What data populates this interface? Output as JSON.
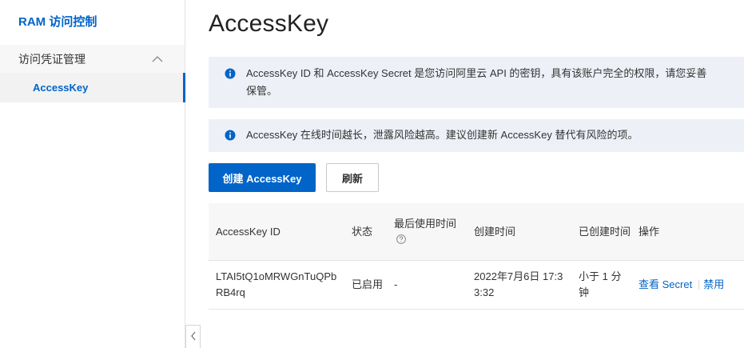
{
  "sidebar": {
    "brand": "RAM 访问控制",
    "group_label": "访问凭证管理",
    "items": [
      {
        "label": "AccessKey"
      }
    ]
  },
  "main": {
    "title": "AccessKey",
    "notices": [
      {
        "text": "AccessKey ID 和 AccessKey Secret 是您访问阿里云 API 的密钥，具有该账户完全的权限，请您妥善保管。"
      },
      {
        "text": "AccessKey 在线时间越长，泄露风险越高。建议创建新 AccessKey 替代有风险的项。"
      }
    ],
    "buttons": {
      "create": "创建 AccessKey",
      "refresh": "刷新"
    },
    "table": {
      "headers": {
        "id": "AccessKey ID",
        "status": "状态",
        "last_used": "最后使用时间",
        "created": "创建时间",
        "created_ago": "已创建时间",
        "actions": "操作"
      },
      "rows": [
        {
          "id": "LTAI5tQ1oMRWGnTuQPbRB4rq",
          "status": "已启用",
          "last_used": "-",
          "created": "2022年7月6日 17:33:32",
          "created_ago": "小于 1 分钟",
          "action_view": "查看 Secret",
          "action_disable": "禁用"
        }
      ]
    }
  },
  "icons": {
    "info": "info-circle-icon",
    "help": "question-circle-icon",
    "chevron": "chevron-up-icon",
    "collapse": "chevron-left-icon"
  },
  "colors": {
    "accent": "#0064c8",
    "notice_bg": "#edf1f7",
    "header_bg": "#f7f7f7"
  }
}
